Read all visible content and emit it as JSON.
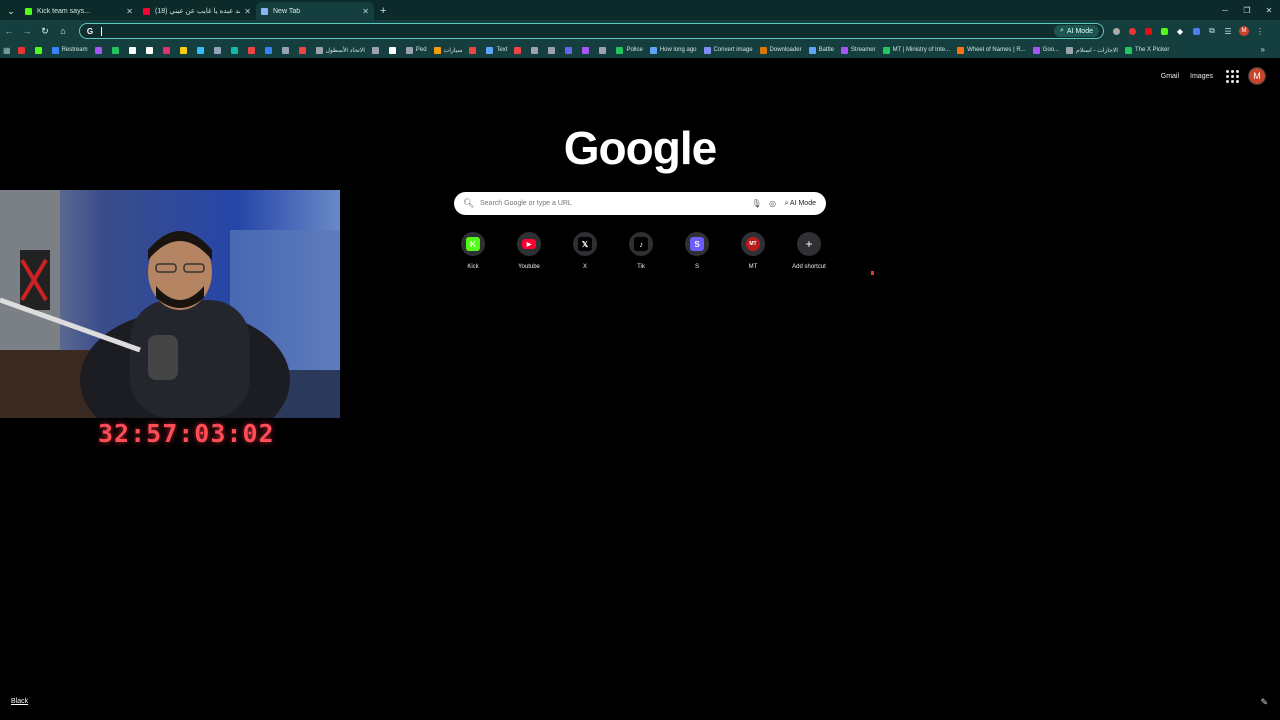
{
  "tabs": [
    {
      "title": "Kick team says...",
      "color": "#53fc18"
    },
    {
      "title": "(18) محمد عبده يا غايب عن عيني",
      "color": "#ff0033"
    },
    {
      "title": "New Tab",
      "color": "#8ab4f8",
      "active": true
    }
  ],
  "toolbar": {
    "omnibox_value": "",
    "ai_mode_label": "AI Mode",
    "profile_initial": "M"
  },
  "bookmarks": [
    {
      "label": "",
      "color": "#e33"
    },
    {
      "label": "",
      "color": "#53fc18"
    },
    {
      "label": "Restream",
      "color": "#3b82f6"
    },
    {
      "label": "",
      "color": "#a855f7"
    },
    {
      "label": "",
      "color": "#22c55e"
    },
    {
      "label": "",
      "color": "#ffffff"
    },
    {
      "label": "",
      "color": "#ffffff"
    },
    {
      "label": "",
      "color": "#e1306c"
    },
    {
      "label": "",
      "color": "#facc15"
    },
    {
      "label": "",
      "color": "#38bdf8"
    },
    {
      "label": "",
      "color": "#94a3b8"
    },
    {
      "label": "",
      "color": "#14b8a6"
    },
    {
      "label": "",
      "color": "#ef4444"
    },
    {
      "label": "",
      "color": "#3b82f6"
    },
    {
      "label": "",
      "color": "#94a3b8"
    },
    {
      "label": "",
      "color": "#ef4444"
    },
    {
      "label": "الاتحاد الأسطول",
      "color": "#9ca3af"
    },
    {
      "label": "",
      "color": "#9ca3af"
    },
    {
      "label": "",
      "color": "#ffffff"
    },
    {
      "label": "Ped",
      "color": "#9ca3af"
    },
    {
      "label": "سيارات",
      "color": "#f59e0b"
    },
    {
      "label": "",
      "color": "#ef4444"
    },
    {
      "label": "Text",
      "color": "#60a5fa"
    },
    {
      "label": "",
      "color": "#ef4444"
    },
    {
      "label": "",
      "color": "#9ca3af"
    },
    {
      "label": "",
      "color": "#9ca3af"
    },
    {
      "label": "",
      "color": "#6366f1"
    },
    {
      "label": "",
      "color": "#a855f7"
    },
    {
      "label": "",
      "color": "#9ca3af"
    },
    {
      "label": "Police",
      "color": "#22c55e"
    },
    {
      "label": "How long ago",
      "color": "#60a5fa"
    },
    {
      "label": "Convert image",
      "color": "#818cf8"
    },
    {
      "label": "Downloader",
      "color": "#d97706"
    },
    {
      "label": "Battle",
      "color": "#60a5fa"
    },
    {
      "label": "Streamer",
      "color": "#a855f7"
    },
    {
      "label": "MT | Ministry of Inte...",
      "color": "#22c55e"
    },
    {
      "label": "Wheel of Names | R...",
      "color": "#f97316"
    },
    {
      "label": "Goo...",
      "color": "#a855f7"
    },
    {
      "label": "الاجازات - استلام",
      "color": "#9ca3af"
    },
    {
      "label": "The X Picker",
      "color": "#22c55e"
    }
  ],
  "top_links": {
    "gmail": "Gmail",
    "images": "Images",
    "avatar_initial": "M"
  },
  "logo_text": "Google",
  "search": {
    "placeholder": "Search Google or type a URL",
    "ai_mode": "AI Mode"
  },
  "shortcuts": [
    {
      "label": "Kick",
      "glyph": "K",
      "color": "#53fc18",
      "icon": "kick-icon"
    },
    {
      "label": "Youtube",
      "glyph": "▶",
      "color": "#ff0033",
      "icon": "youtube-icon"
    },
    {
      "label": "X",
      "glyph": "𝕏",
      "color": "#000000",
      "icon": "x-icon"
    },
    {
      "label": "Tik",
      "glyph": "♪",
      "color": "#000000",
      "icon": "tiktok-icon"
    },
    {
      "label": "S",
      "glyph": "S",
      "color": "#6d5dfc",
      "icon": "s-icon"
    },
    {
      "label": "MT",
      "glyph": "MT",
      "color": "#b91c1c",
      "icon": "mt-icon"
    },
    {
      "label": "Add shortcut",
      "glyph": "+",
      "color": "#2f3033",
      "icon": "plus-icon"
    }
  ],
  "timer": "32:57:03:02",
  "bottom_link": "Black"
}
